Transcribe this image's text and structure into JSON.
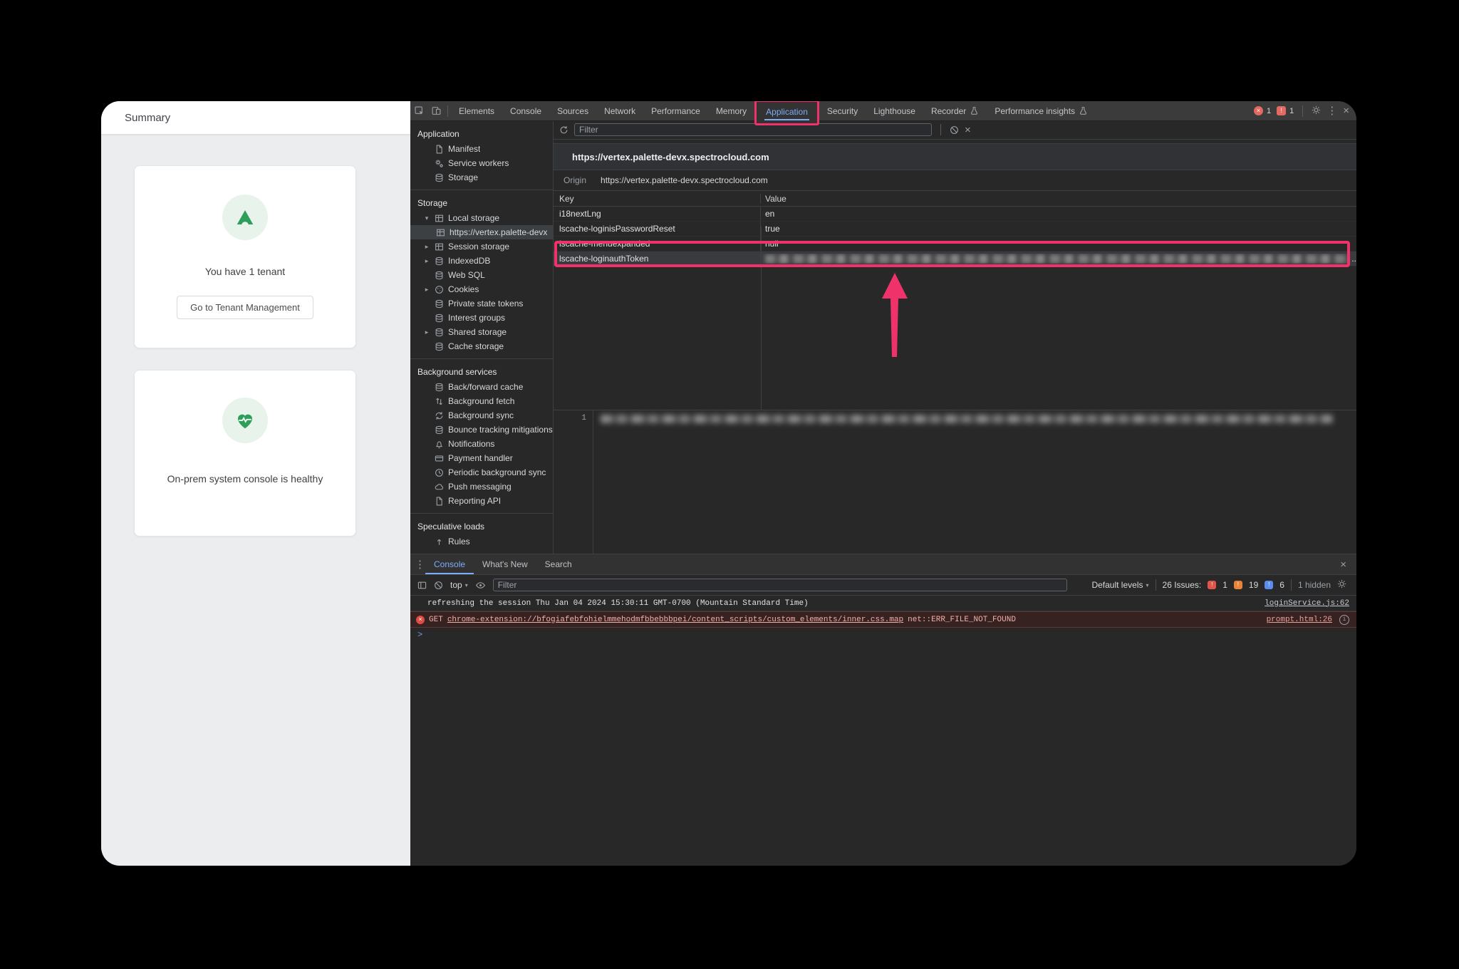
{
  "colors": {
    "accent_pink": "#f0326b",
    "devtools_blue": "#7cacf8",
    "brand_green": "#2e9e5b"
  },
  "page": {
    "title": "Summary",
    "cards": [
      {
        "icon": "tenant-logo",
        "text": "You have 1 tenant",
        "button": "Go to Tenant Management"
      },
      {
        "icon": "heart-pulse",
        "text": "On-prem system console is healthy"
      }
    ]
  },
  "dt": {
    "tabs": [
      "Elements",
      "Console",
      "Sources",
      "Network",
      "Performance",
      "Memory",
      "Application",
      "Security",
      "Lighthouse",
      "Recorder",
      "Performance insights"
    ],
    "active_tab": "Application",
    "badges": {
      "error_count": "1",
      "issue_count": "1"
    },
    "sb": {
      "sec1": "Application",
      "app_items": [
        "Manifest",
        "Service workers",
        "Storage"
      ],
      "sec2": "Storage",
      "storage_items": [
        "Local storage",
        "https://vertex.palette-devx",
        "Session storage",
        "IndexedDB",
        "Web SQL",
        "Cookies",
        "Private state tokens",
        "Interest groups",
        "Shared storage",
        "Cache storage"
      ],
      "sec3": "Background services",
      "bg_items": [
        "Back/forward cache",
        "Background fetch",
        "Background sync",
        "Bounce tracking mitigations",
        "Notifications",
        "Payment handler",
        "Periodic background sync",
        "Push messaging",
        "Reporting API"
      ],
      "sec4": "Speculative loads",
      "spec_items": [
        "Rules"
      ]
    },
    "storage": {
      "filter_placeholder": "Filter",
      "url": "https://vertex.palette-devx.spectrocloud.com",
      "origin_label": "Origin",
      "origin": "https://vertex.palette-devx.spectrocloud.com",
      "columns": [
        "Key",
        "Value"
      ],
      "rows": [
        {
          "key": "i18nextLng",
          "value": "en"
        },
        {
          "key": "lscache-loginisPasswordReset",
          "value": "true"
        },
        {
          "key": "lscache-menuexpanded",
          "value": "null"
        },
        {
          "key": "lscache-loginauthToken",
          "value": "",
          "blurred": true
        }
      ],
      "truncation": "..",
      "line_no": "1"
    }
  },
  "dc": {
    "tabs": [
      "Console",
      "What's New",
      "Search"
    ],
    "active_tab": "Console",
    "context": "top",
    "filter_placeholder": "Filter",
    "levels": "Default levels",
    "issues_label": "26 Issues:",
    "counts": [
      "1",
      "19",
      "6"
    ],
    "hidden": "1 hidden",
    "msg1": {
      "text": "refreshing the session Thu Jan 04 2024 15:30:11 GMT-0700 (Mountain Standard Time)",
      "src": "loginService.js:62"
    },
    "msg2": {
      "method": "GET",
      "url": "chrome-extension://bfogiafebfohielmmehodmfbbebbbpei/content_scripts/custom_elements/inner.css.map",
      "err": "net::ERR_FILE_NOT_FOUND",
      "src": "prompt.html:26"
    },
    "prompt": ">"
  }
}
